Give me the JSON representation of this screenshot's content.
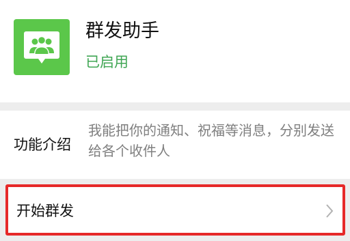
{
  "app": {
    "title": "群发助手",
    "status": "已启用",
    "icon": "group-broadcast-icon",
    "icon_color": "#5bc74a",
    "status_color": "#3fa653"
  },
  "feature": {
    "label": "功能介绍",
    "description": "我能把你的通知、祝福等消息，分别发送给各个收件人"
  },
  "actions": {
    "start_label": "开始群发",
    "start_icon": "chevron-right-icon",
    "highlight_color": "#e62929"
  }
}
